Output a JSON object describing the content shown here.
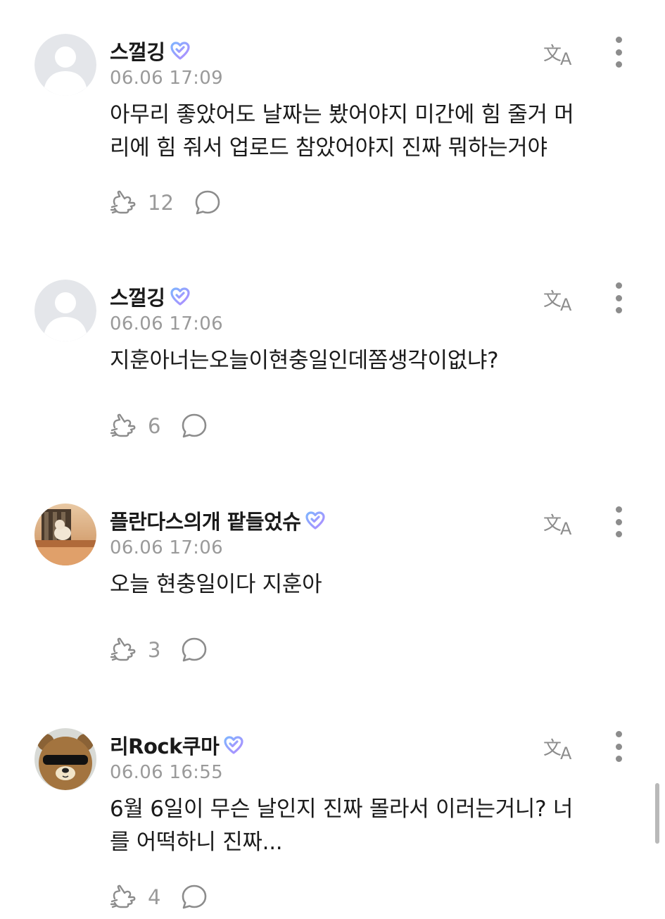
{
  "colors": {
    "text": "#1a1a1a",
    "meta": "#9a9a9a",
    "badge_gradient": [
      "#7fb3ff",
      "#b18cff"
    ]
  },
  "icons": {
    "translate": "translate-icon",
    "more": "more-vertical-icon",
    "like": "heart-hands-icon",
    "reply": "speech-bubble-icon",
    "badge": "verified-heart-badge-icon"
  },
  "comments": [
    {
      "nickname": "스껄깅",
      "avatar": "default",
      "time": "06.06 17:09",
      "lines": [
        "아무리 좋았어도 날짜는 봤어야지 미간에 힘 줄거 머",
        "리에 힘 줘서 업로드 참았어야지 진짜 뭐하는거야"
      ],
      "likes": "12"
    },
    {
      "nickname": "스껄깅",
      "avatar": "default",
      "time": "06.06 17:06",
      "lines": [
        "지훈아너는오늘이현충일인데쫌생각이없냐?"
      ],
      "likes": "6"
    },
    {
      "nickname": "플란다스의개 팥들었슈",
      "avatar": "photo-dog",
      "time": "06.06 17:06",
      "lines": [
        "오늘 현충일이다 지훈아"
      ],
      "likes": "3"
    },
    {
      "nickname": "리Rock쿠마",
      "avatar": "bear",
      "time": "06.06 16:55",
      "lines": [
        "6월 6일이 무슨 날인지 진짜 몰라서 이러는거니? 너",
        "를 어떡하니 진짜..."
      ],
      "likes": "4"
    }
  ]
}
